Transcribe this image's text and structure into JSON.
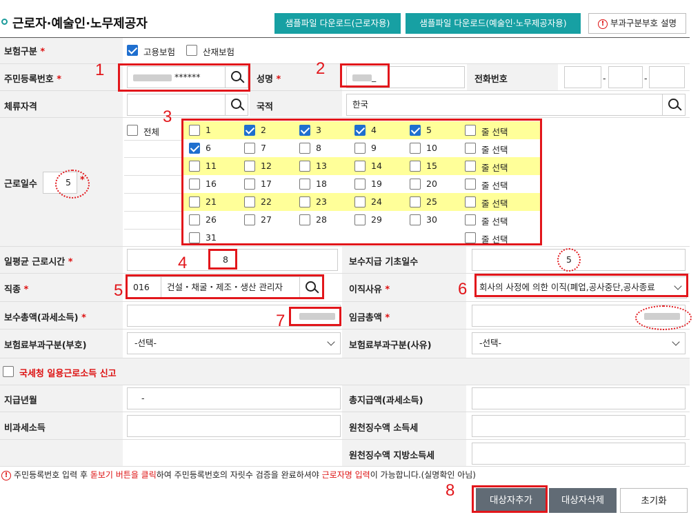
{
  "header": {
    "title": "근로자·예술인·노무제공자",
    "btn_sample_worker": "샘플파일 다운로드(근로자용)",
    "btn_sample_artist": "샘플파일 다운로드(예술인·노무제공자용)",
    "btn_guide": "부과구분부호 설명"
  },
  "insurance": {
    "label": "보험구분",
    "employment": "고용보험",
    "industrial": "산재보험"
  },
  "rrn": {
    "label": "주민등록번호",
    "masked": "******",
    "name_label": "성명",
    "name_suffix": "_",
    "phone_label": "전화번호",
    "phone_sep": "-"
  },
  "visa": {
    "label": "체류자격",
    "nationality_label": "국적",
    "nationality": "한국"
  },
  "work_days": {
    "label": "근로일수",
    "count": "5",
    "all_label": "전체",
    "row_select_label": "줄 선택",
    "rows": [
      [
        "1",
        "2",
        "3",
        "4",
        "5"
      ],
      [
        "6",
        "7",
        "8",
        "9",
        "10"
      ],
      [
        "11",
        "12",
        "13",
        "14",
        "15"
      ],
      [
        "16",
        "17",
        "18",
        "19",
        "20"
      ],
      [
        "21",
        "22",
        "23",
        "24",
        "25"
      ],
      [
        "26",
        "27",
        "28",
        "29",
        "30"
      ],
      [
        "31"
      ]
    ],
    "checked": [
      "2",
      "3",
      "4",
      "5",
      "6"
    ]
  },
  "hours": {
    "label": "일평균 근로시간",
    "value": "8",
    "base_days_label": "보수지급 기초일수",
    "base_days": "5"
  },
  "job": {
    "label": "직종",
    "code": "016",
    "name": "건설・채굴・제조・생산 관리자",
    "reason_label": "이직사유",
    "reason": "회사의 사정에 의한 이직(폐업,공사중단,공사종료"
  },
  "pay": {
    "total_label": "보수총액(과세소득)",
    "wage_label": "임금총액"
  },
  "levy": {
    "code_label": "보험료부과구분(부호)",
    "reason_label": "보험료부과구분(사유)",
    "placeholder": "-선택-"
  },
  "tax": {
    "report_label": "국세청 일용근로소득 신고",
    "pay_month_label": "지급년월",
    "pay_month_sep": "-",
    "total_pay_label": "총지급액(과세소득)",
    "nontax_label": "비과세소득",
    "income_tax_label": "원천징수액 소득세",
    "local_tax_label": "원천징수액 지방소득세"
  },
  "note": {
    "part1": "주민등록번호 입력 후 ",
    "hl1": "돋보기 버튼을 클릭",
    "part2": "하여 주민등록번호의 자릿수 검증을 완료하셔야 ",
    "hl2": "근로자명 입력",
    "part3": "이 가능합니다.(실명확인 아님)"
  },
  "buttons": {
    "add": "대상자추가",
    "delete": "대상자삭제",
    "reset": "초기화"
  },
  "annotations": [
    "1",
    "2",
    "3",
    "4",
    "5",
    "6",
    "7",
    "8"
  ],
  "colors": {
    "teal": "#17a0a3",
    "annotation_red": "#e2161b",
    "highlight_yellow": "#ffff99",
    "check_blue": "#1f6fcf",
    "button_dark": "#616b75"
  }
}
